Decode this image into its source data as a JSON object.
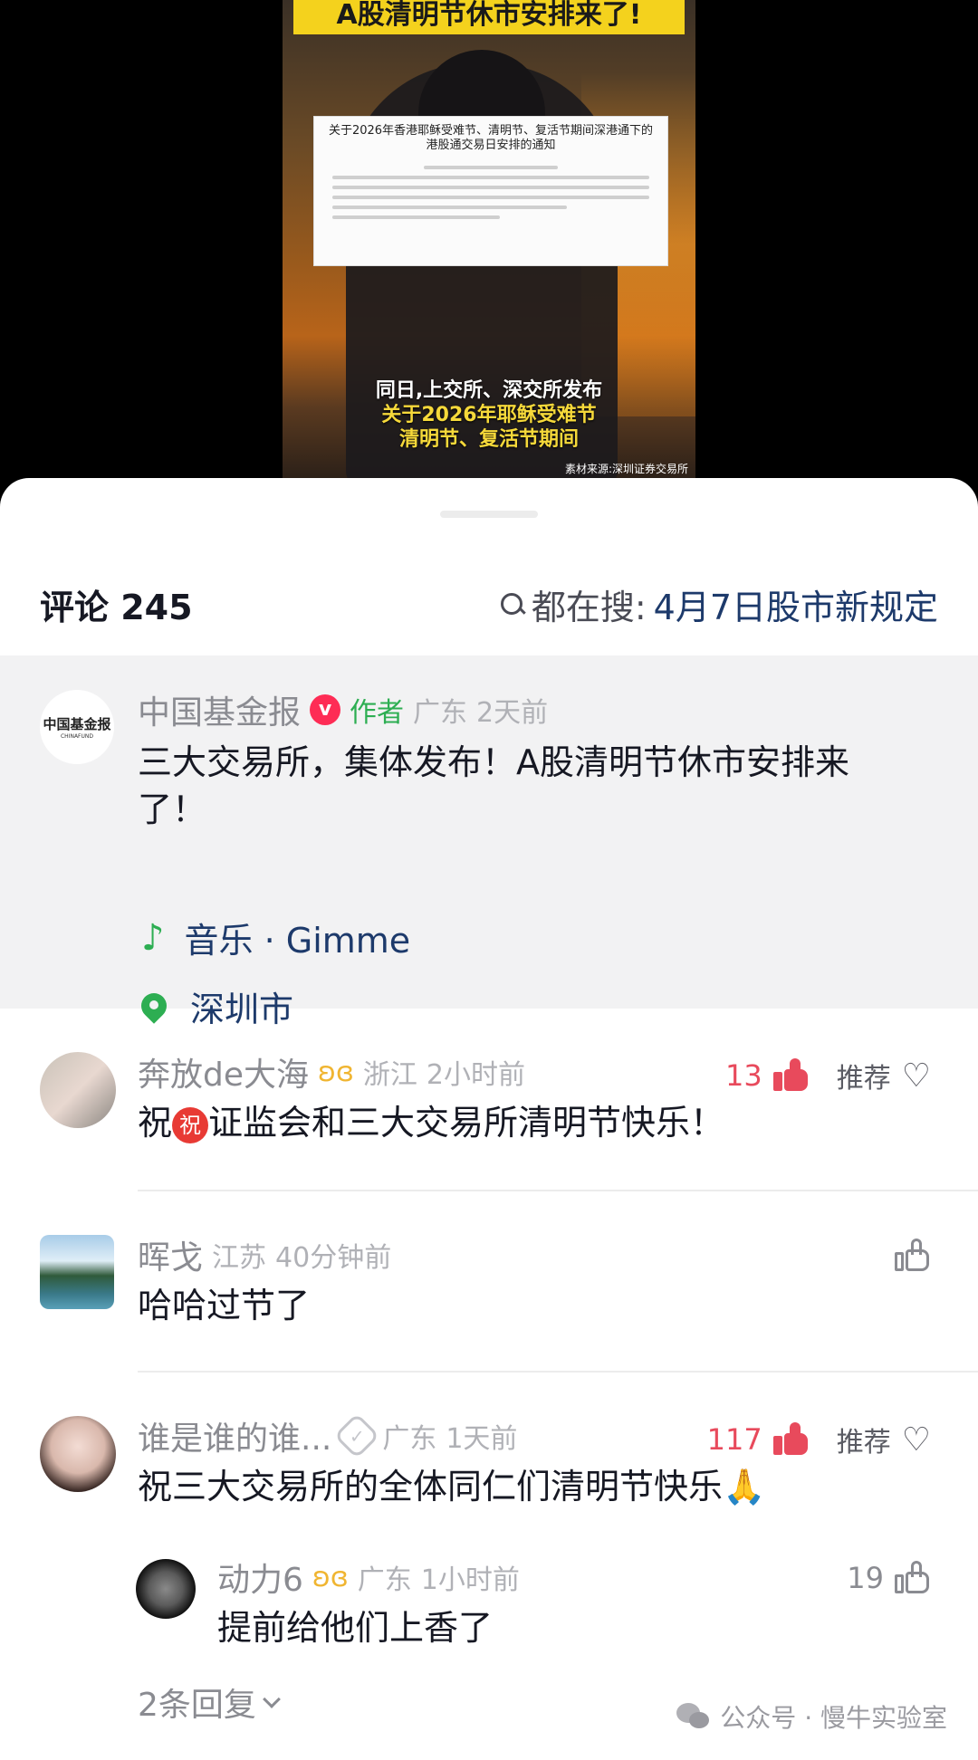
{
  "video": {
    "banner": "A股清明节休市安排来了!",
    "notice_title": "关于2026年香港耶稣受难节、清明节、复活节期间深港通下的港股通交易日安排的通知",
    "caption_line1": "同日,上交所、深交所发布",
    "caption_line2": "关于2026年耶稣受难节",
    "caption_line3": "清明节、复活节期间",
    "source": "素材来源:深圳证券交易所"
  },
  "header": {
    "title": "评论 245",
    "search_label": "都在搜:",
    "search_keyword": "4月7日股市新规定"
  },
  "pinned": {
    "avatar_logo_cn": "中国基金报",
    "avatar_logo_en": "CHINAFUND",
    "name": "中国基金报",
    "verified_badge": "v",
    "author_tag": "作者",
    "location": "广东",
    "time": "2天前",
    "content": "三大交易所，集体发布！A股清明节休市安排来了！",
    "music_label": "音乐 · Gimme",
    "location_tag": "深圳市"
  },
  "comments": [
    {
      "name": "奔放de大海",
      "location": "浙江",
      "time": "2小时前",
      "content_prefix": "祝",
      "content_badge": "祝",
      "content": "证监会和三大交易所清明节快乐！",
      "likes": "13",
      "recommend": "推荐"
    },
    {
      "name": "晖戈",
      "location": "江苏",
      "time": "40分钟前",
      "content": "哈哈过节了"
    },
    {
      "name": "谁是谁的谁...",
      "location": "广东",
      "time": "1天前",
      "content": "祝三大交易所的全体同仁们清明节快乐🙏",
      "likes": "117",
      "recommend": "推荐"
    }
  ],
  "reply": {
    "name": "动力6",
    "location": "广东",
    "time": "1小时前",
    "content": "提前给他们上香了",
    "likes": "19"
  },
  "expand_label": "2条回复",
  "watermark": "公众号 · 慢牛实验室",
  "colors": {
    "accent_red": "#e84a5c",
    "link_blue": "#1d3a6b",
    "author_green": "#2dae52"
  }
}
